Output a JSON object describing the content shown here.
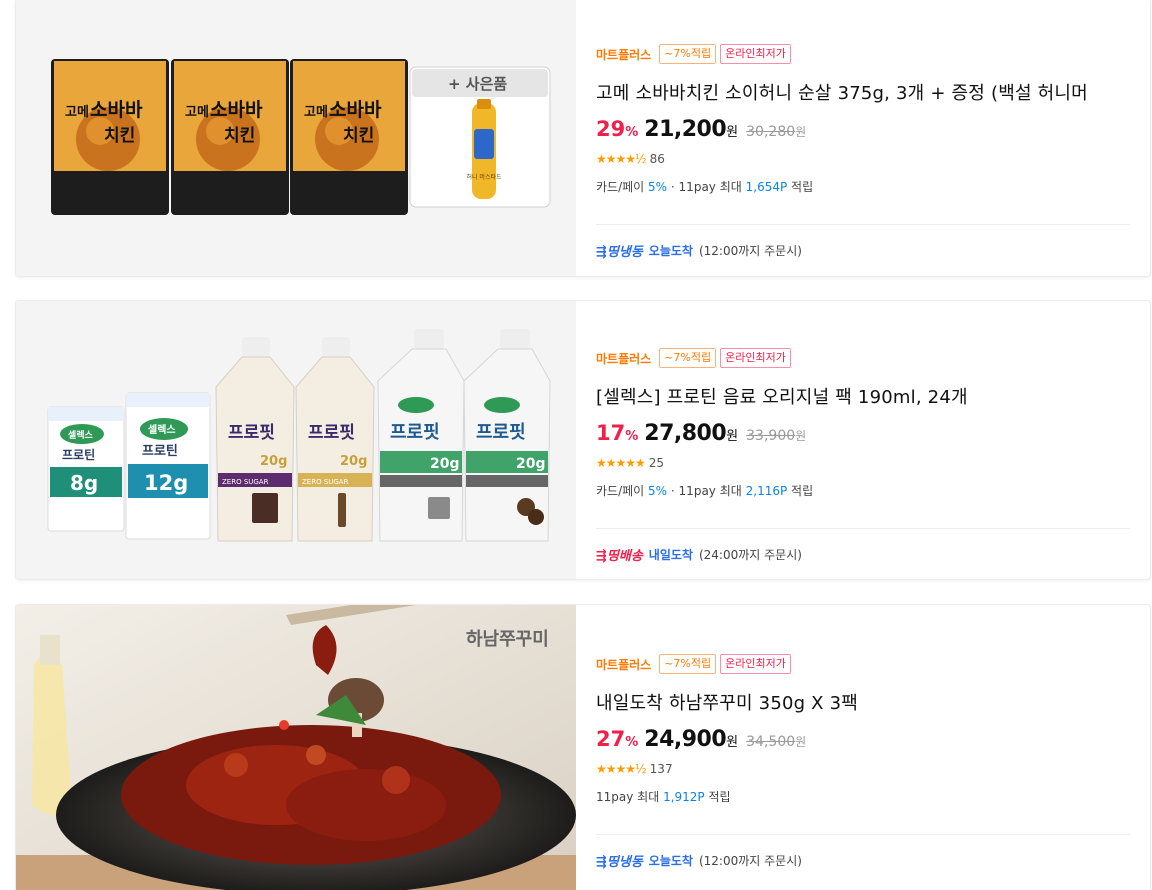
{
  "products": [
    {
      "mart_label": "마트플러스",
      "rate_badge": "~7%적립",
      "lowest_badge": "온라인최저가",
      "title": "고메 소바바치킨 소이허니 순살 375g, 3개 + 증정 (백설 허니머",
      "discount": "29",
      "discount_unit": "%",
      "price": "21,200",
      "price_unit": "원",
      "original_price": "30,280",
      "original_unit": "원",
      "stars": "★★★★½",
      "review_count": "86",
      "benefit_prefix": "카드/페이",
      "benefit_card_rate": "5%",
      "benefit_mid": "· 11pay 최대",
      "benefit_points": "1,654P",
      "benefit_suffix": "적립",
      "ship_logo": "⇶띵냉동",
      "ship_when": "오늘도착",
      "ship_note": "(12:00까지 주문시)",
      "image": {
        "pack_brand": "고메",
        "pack_title_1": "소바바",
        "pack_title_2": "치킨",
        "gift_label": "+ 사은품",
        "gift_bottle_text": "허니 머스타드"
      }
    },
    {
      "mart_label": "마트플러스",
      "rate_badge": "~7%적립",
      "lowest_badge": "온라인최저가",
      "title": "[셀렉스] 프로틴 음료 오리지널 팩 190ml, 24개",
      "discount": "17",
      "discount_unit": "%",
      "price": "27,800",
      "price_unit": "원",
      "original_price": "33,900",
      "original_unit": "원",
      "stars": "★★★★★",
      "review_count": "25",
      "benefit_prefix": "카드/페이",
      "benefit_card_rate": "5%",
      "benefit_mid": "· 11pay 최대",
      "benefit_points": "2,116P",
      "benefit_suffix": "적립",
      "ship_logo": "⇶띵배송",
      "ship_when": "내일도착",
      "ship_note": "(24:00까지 주문시)",
      "image": {
        "brand": "셀렉스",
        "box_label": "프로틴",
        "box1_grams": "8g",
        "box2_grams": "12g",
        "carton_label": "프로핏",
        "carton_grams": "20g",
        "zero_sugar": "ZERO SUGAR"
      }
    },
    {
      "mart_label": "마트플러스",
      "rate_badge": "~7%적립",
      "lowest_badge": "온라인최저가",
      "title": "내일도착 하남쭈꾸미 350g X 3팩",
      "discount": "27",
      "discount_unit": "%",
      "price": "24,900",
      "price_unit": "원",
      "original_price": "34,500",
      "original_unit": "원",
      "stars": "★★★★½",
      "review_count": "137",
      "benefit_prefix": "",
      "benefit_card_rate": "",
      "benefit_mid": "11pay 최대",
      "benefit_points": "1,912P",
      "benefit_suffix": "적립",
      "ship_logo": "⇶띵냉동",
      "ship_when": "오늘도착",
      "ship_note": "(12:00까지 주문시)",
      "image": {
        "watermark": "하남쭈꾸미"
      }
    }
  ],
  "colors": {
    "accent_red": "#f1204a",
    "accent_orange": "#ff7a00",
    "link_blue": "#0b83e6",
    "ship_blue": "#2b6ee8",
    "star": "#ff9c00"
  }
}
